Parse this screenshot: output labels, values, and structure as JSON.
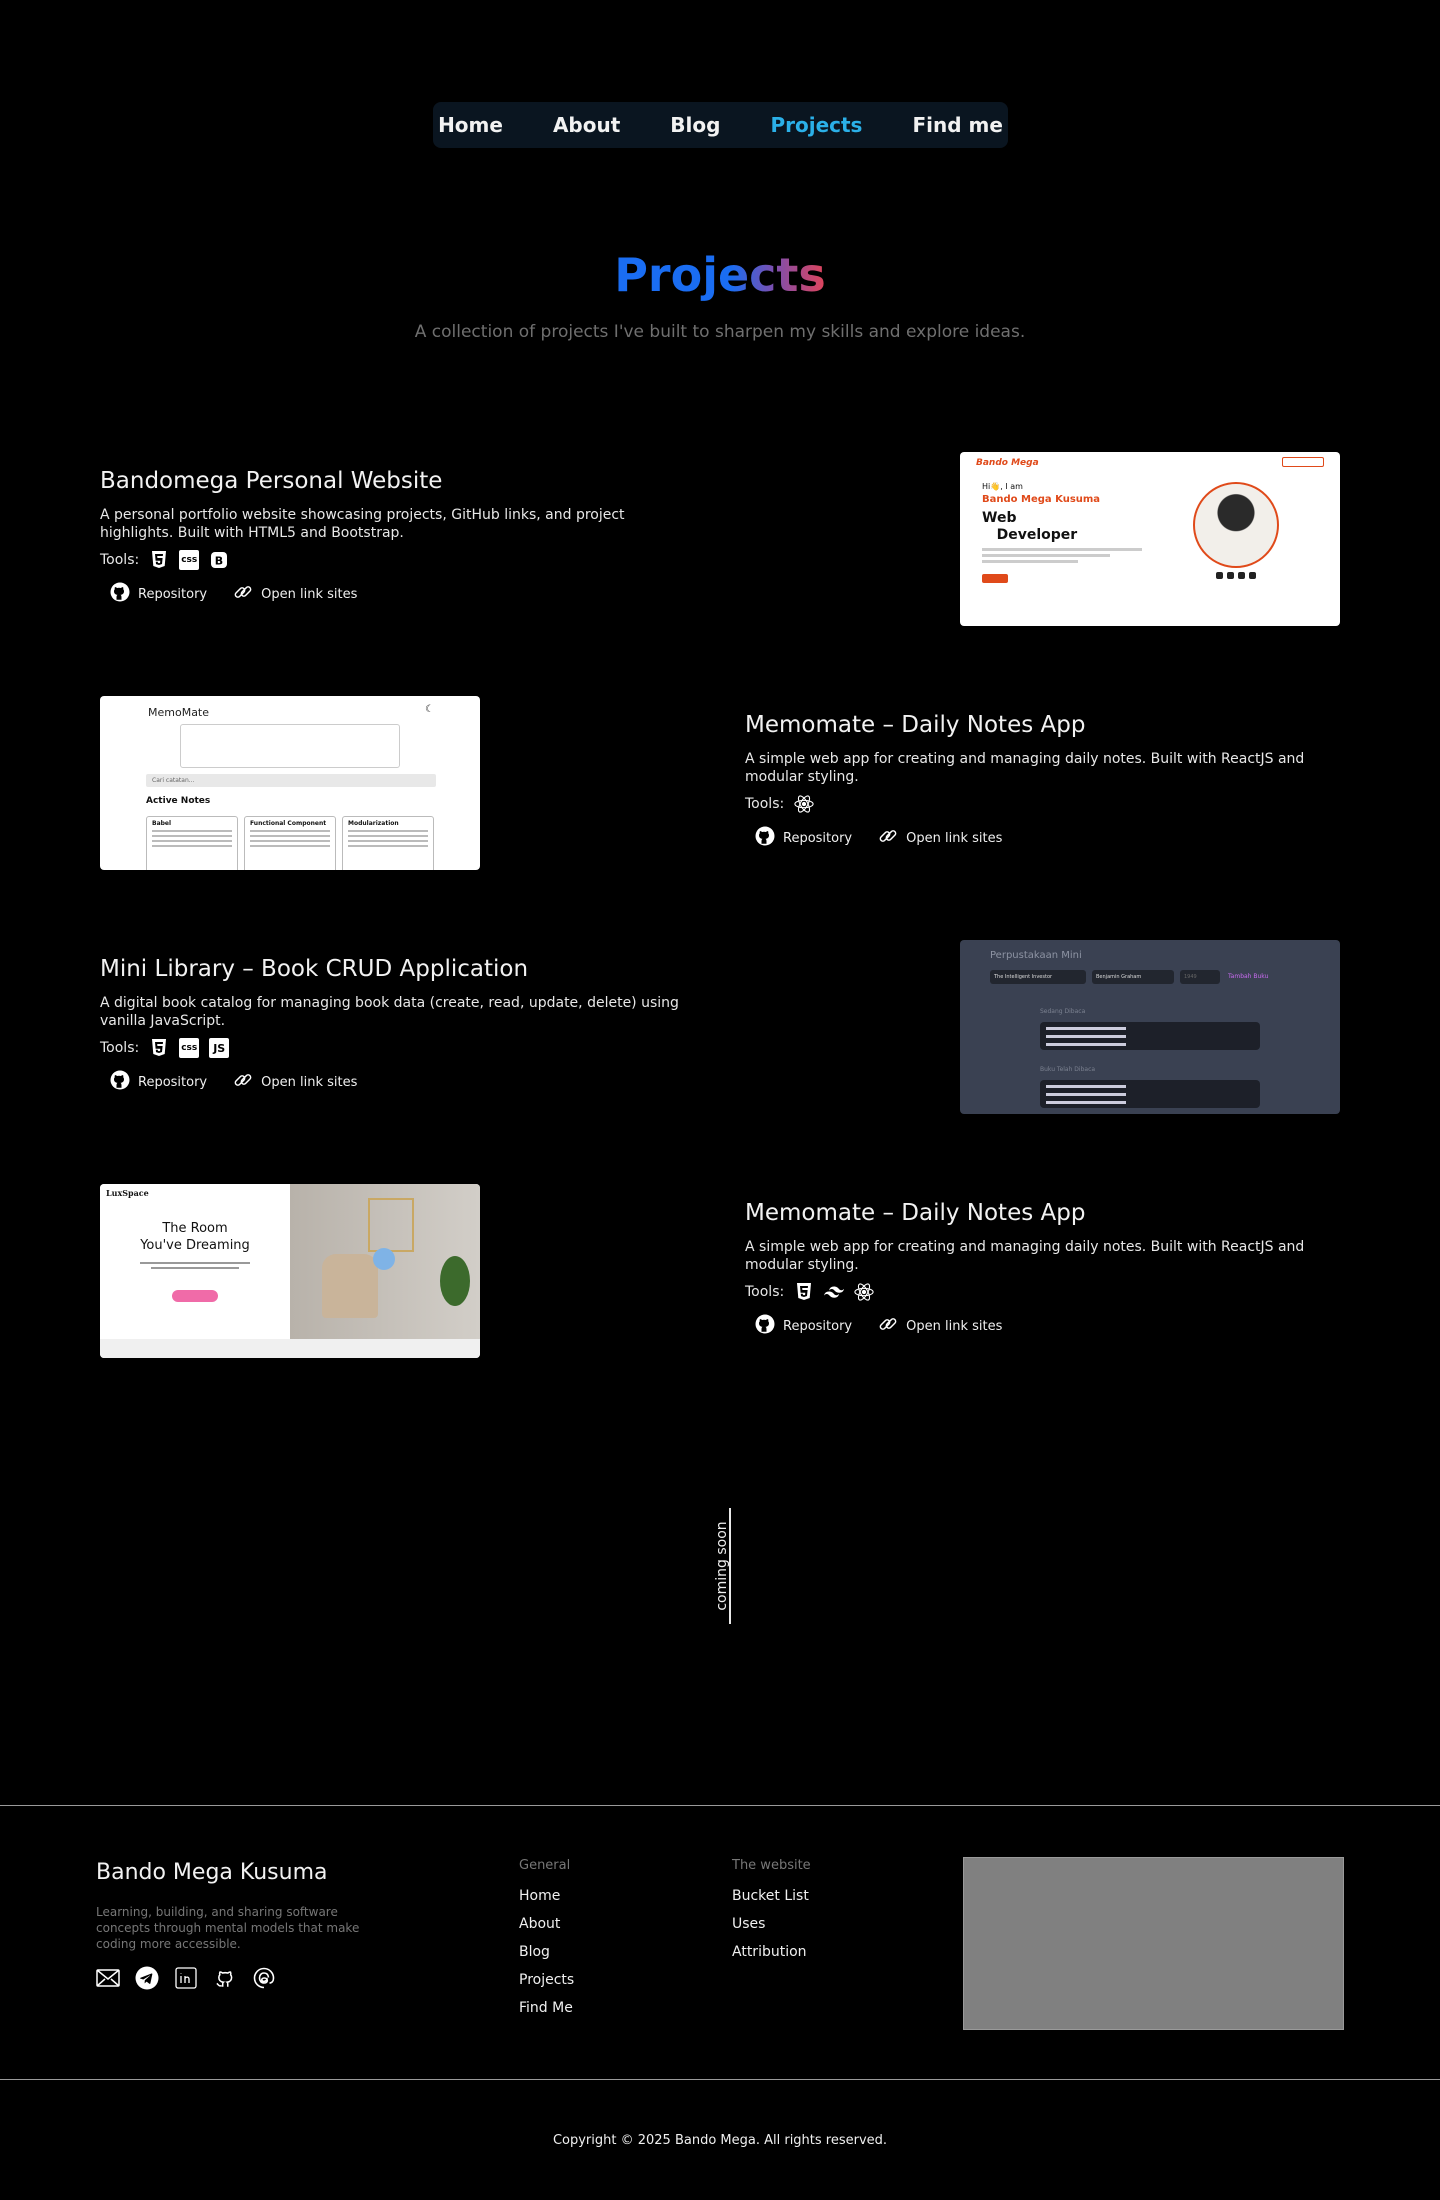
{
  "nav": {
    "items": [
      {
        "label": "Home",
        "active": false
      },
      {
        "label": "About",
        "active": false
      },
      {
        "label": "Blog",
        "active": false
      },
      {
        "label": "Projects",
        "active": true
      },
      {
        "label": "Find me",
        "active": false
      }
    ],
    "active_color": "#2bb0e8"
  },
  "header": {
    "title": "Projects",
    "subtitle": "A collection of projects I've built to sharpen my skills and explore ideas."
  },
  "tools_label": "Tools:",
  "projects": [
    {
      "title": "Bandomega Personal Website",
      "description": "A personal portfolio website showcasing projects, GitHub links, and project highlights. Built with HTML5 and Bootstrap.",
      "tools": [
        "html5-icon",
        "css-icon",
        "bootstrap-icon"
      ],
      "repo_label": "Repository",
      "site_label": "Open link sites",
      "preview": {
        "brand": "Bando Mega",
        "greeting": "Hi👋, I am",
        "name": "Bando Mega Kusuma",
        "role_1": "Web",
        "role_2": "Developer"
      }
    },
    {
      "title": "Memomate – Daily Notes App",
      "description": "A simple web app for creating and managing daily notes. Built with ReactJS and modular styling.",
      "tools": [
        "react-icon"
      ],
      "repo_label": "Repository",
      "site_label": "Open link sites",
      "preview": {
        "logo": "MemoMate",
        "search": "Cari catatan...",
        "section": "Active Notes",
        "cards": [
          "Babel",
          "Functional Component",
          "Modularization"
        ]
      }
    },
    {
      "title": "Mini Library – Book CRUD Application",
      "description": "A digital book catalog for managing book data (create, read, update, delete) using vanilla JavaScript.",
      "tools": [
        "html5-icon",
        "css-icon",
        "js-icon"
      ],
      "repo_label": "Repository",
      "site_label": "Open link sites",
      "preview": {
        "title": "Perpustakaan Mini",
        "input_1": "The Intelligent Investor",
        "input_2": "Benjamin Graham",
        "input_3": "1949",
        "add_label": "Tambah Buku",
        "reading": "Sedang Dibaca",
        "finished": "Buku Telah Dibaca"
      }
    },
    {
      "title": "Memomate – Daily Notes App",
      "description": "A simple web app for creating and managing daily notes. Built with ReactJS and modular styling.",
      "tools": [
        "html5-icon",
        "tailwind-icon",
        "react-icon"
      ],
      "repo_label": "Repository",
      "site_label": "Open link sites",
      "preview": {
        "brand": "LuxSpace",
        "headline_1": "The Room",
        "headline_2": "You've Dreaming"
      }
    }
  ],
  "coming_soon": "coming soon",
  "footer": {
    "name": "Bando Mega Kusuma",
    "description": "Learning, building, and sharing software concepts through mental models that make coding more accessible.",
    "socials": [
      "mail-icon",
      "telegram-icon",
      "linkedin-icon",
      "github-icon",
      "threads-icon"
    ],
    "general_heading": "General",
    "general_links": [
      "Home",
      "About",
      "Blog",
      "Projects",
      "Find Me"
    ],
    "website_heading": "The website",
    "website_links": [
      "Bucket List",
      "Uses",
      "Attribution"
    ],
    "copyright": "Copyright © 2025 Bando Mega. All rights reserved."
  }
}
